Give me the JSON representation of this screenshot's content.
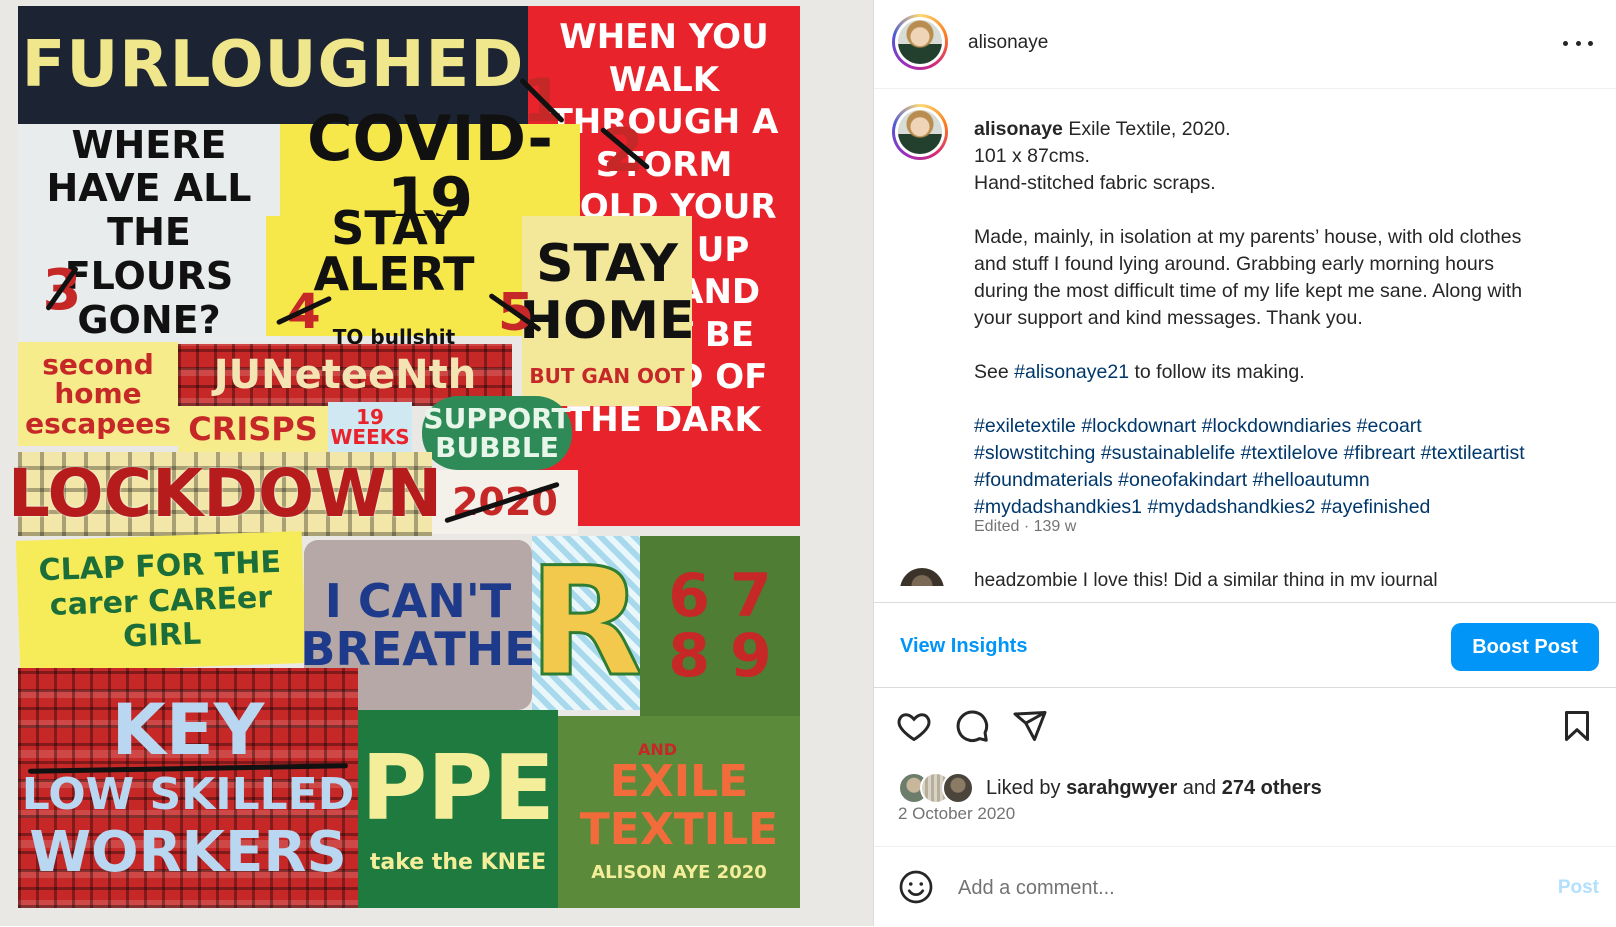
{
  "post": {
    "author": "alisonaye",
    "more_label": "More options"
  },
  "caption": {
    "username": "alisonaye",
    "line1": "Exile Textile, 2020.",
    "line2": "101 x 87cms.",
    "line3": "Hand-stitched fabric scraps.",
    "p1_l1": "Made, mainly, in isolation at my parents’ house, with old clothes",
    "p1_l2": "and stuff I found lying around. Grabbing early morning hours",
    "p1_l3": "during the most difficult time of my life kept me sane. Along with",
    "p1_l4": "your support and kind messages. Thank you.",
    "see_pre": "See",
    "see_tag": "#alisonaye21",
    "see_post": "to follow its making.",
    "hashtags": [
      [
        "#exiletextile",
        "#lockdownart",
        "#lockdowndiaries",
        "#ecoart"
      ],
      [
        "#slowstitching",
        "#sustainablelife",
        "#textilelove",
        "#fibreart",
        "#textileartist"
      ],
      [
        "#foundmaterials",
        "#oneofakindart",
        "#helloautumn"
      ],
      [
        "#mydadshandkies1",
        "#mydadshandkies2",
        "#ayefinished"
      ]
    ],
    "edited": "Edited · 139 w",
    "comment_peek": "headzombie I love this! Did a similar thing in my journal"
  },
  "insights": {
    "view_label": "View Insights",
    "boost_label": "Boost Post"
  },
  "engagement": {
    "liked_by_pre": "Liked by",
    "liked_by_user": "sarahgwyer",
    "liked_by_and": "and",
    "liked_by_count": "274 others",
    "date": "2 October 2020"
  },
  "comment_box": {
    "placeholder": "Add a comment...",
    "post_label": "Post"
  },
  "artwork": {
    "furloughed": "FURLOUGHED",
    "when_you_walk": "WHEN YOU WALK THROUGH A STORM HOLD YOUR HEAD UP HIGH AND DON'T BE AFRAID OF THE DARK",
    "where_have": "WHERE HAVE ALL THE FLOURS GONE?",
    "covid": "COVID-19",
    "stay_alert": "STAY ALERT",
    "to_bullshit": "TO bullshit",
    "stay_home": "STAY HOME",
    "but_gan_oot": "BUT GAN OOT",
    "second_home": "second home escapees",
    "juneteenth": "JUNeteeNth",
    "crisps": "CRISPS",
    "weeks": "19 WEEKS",
    "support_bubble": "SUPPORT BUBBLE",
    "year": "2020",
    "lockdown": "LOCKDOWN",
    "clap": "CLAP FOR THE carer CAREer GIRL",
    "cant_breathe": "I CAN'T BREATHE",
    "r": "R",
    "key": "KEY",
    "low_skilled": "LOW SKILLED",
    "workers": "WORKERS",
    "ppe": "PPE",
    "take_knee": "take the KNEE",
    "exile": "EXILE TEXTILE",
    "signature": "ALISON AYE 2020",
    "and": "AND",
    "nums": [
      "1",
      "2",
      "3",
      "4",
      "5",
      "6",
      "7",
      "8",
      "9"
    ]
  },
  "colors": {
    "accent": "#0095f6",
    "link": "#00376b",
    "text": "#262626",
    "muted": "#737373"
  }
}
